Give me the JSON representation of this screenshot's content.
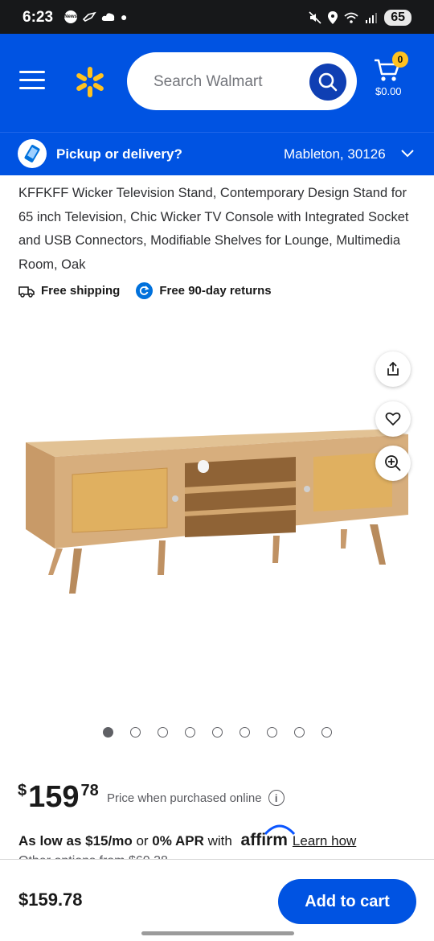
{
  "status_bar": {
    "time": "6:23",
    "news_label": "News",
    "battery": "65"
  },
  "header": {
    "menu_icon": "hamburger-menu-icon",
    "logo_icon": "walmart-spark-icon",
    "search_placeholder": "Search Walmart",
    "cart_count": "0",
    "cart_total": "$0.00",
    "brand_color": "#0053e2",
    "accent_color": "#ffc220"
  },
  "pickup": {
    "label": "Pickup or delivery?",
    "location": "Mableton, 30126"
  },
  "product": {
    "title": "KFFKFF Wicker Television Stand, Contemporary Design Stand for 65 inch Television, Chic Wicker TV Console with Integrated Socket and USB Connectors, Modifiable Shelves for Lounge, Multimedia Room, Oak",
    "benefits": [
      {
        "icon": "truck-icon",
        "label": "Free shipping"
      },
      {
        "icon": "returns-icon",
        "label": "Free 90-day returns"
      }
    ],
    "image_count": 9,
    "active_image": 1
  },
  "price": {
    "currency": "$",
    "whole": "159",
    "cents": "78",
    "note": "Price when purchased online"
  },
  "financing": {
    "prefix": "As low as $15/mo",
    "middle": " or ",
    "apr": "0% APR",
    "with": " with ",
    "provider": "affirm",
    "link": "Learn how",
    "other": "Other options from $60.38"
  },
  "bottom_bar": {
    "price": "$159.78",
    "add_to_cart": "Add to cart"
  }
}
